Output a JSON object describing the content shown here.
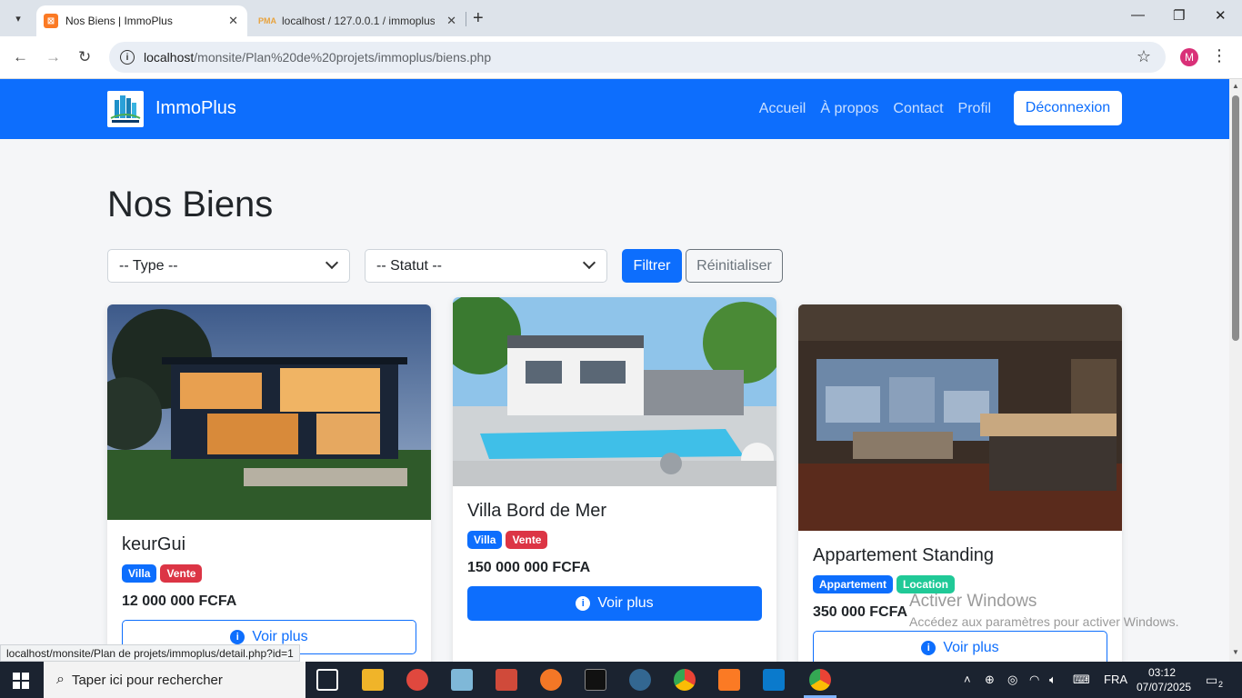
{
  "browser": {
    "tabs": [
      {
        "title": "Nos Biens | ImmoPlus",
        "active": true
      },
      {
        "title": "localhost / 127.0.0.1 / immoplus",
        "active": false
      }
    ],
    "url_host": "localhost",
    "url_path": "/monsite/Plan%20de%20projets/immoplus/biens.php",
    "profile_initial": "M",
    "status_url": "localhost/monsite/Plan de projets/immoplus/detail.php?id=1"
  },
  "site": {
    "brand": "ImmoPlus",
    "nav": [
      "Accueil",
      "À propos",
      "Contact",
      "Profil"
    ],
    "logout": "Déconnexion",
    "page_title": "Nos Biens",
    "filters": {
      "type_placeholder": "-- Type --",
      "statut_placeholder": "-- Statut --",
      "filter_btn": "Filtrer",
      "reset_btn": "Réinitialiser"
    },
    "cards": [
      {
        "title": "keurGui",
        "badge1": "Villa",
        "badge2": "Vente",
        "price": "12 000 000 FCFA",
        "button": "Voir plus"
      },
      {
        "title": "Villa Bord de Mer",
        "badge1": "Villa",
        "badge2": "Vente",
        "price": "150 000 000 FCFA",
        "button": "Voir plus"
      },
      {
        "title": "Appartement Standing",
        "badge1": "Appartement",
        "badge2": "Location",
        "price": "350 000 FCFA",
        "button": "Voir plus"
      }
    ]
  },
  "watermark": {
    "line1": "Activer Windows",
    "line2": "Accédez aux paramètres pour activer Windows."
  },
  "taskbar": {
    "search_placeholder": "Taper ici pour rechercher",
    "lang": "FRA",
    "time": "03:12",
    "date": "07/07/2025",
    "notifications": "2"
  },
  "colors": {
    "primary": "#0d6efd",
    "danger": "#dc3545",
    "success": "#20c997"
  }
}
